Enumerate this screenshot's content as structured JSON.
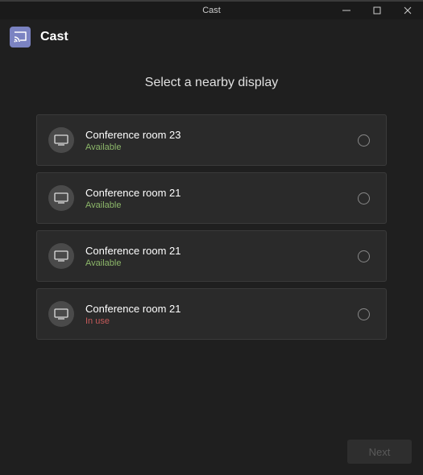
{
  "titlebar": {
    "title": "Cast"
  },
  "header": {
    "title": "Cast"
  },
  "heading": "Select a nearby display",
  "displays": [
    {
      "name": "Conference room 23",
      "status": "Available",
      "statusType": "available"
    },
    {
      "name": "Conference room 21",
      "status": "Available",
      "statusType": "available"
    },
    {
      "name": "Conference room 21",
      "status": "Available",
      "statusType": "available"
    },
    {
      "name": "Conference room 21",
      "status": "In use",
      "statusType": "inuse"
    }
  ],
  "footer": {
    "next_label": "Next"
  }
}
